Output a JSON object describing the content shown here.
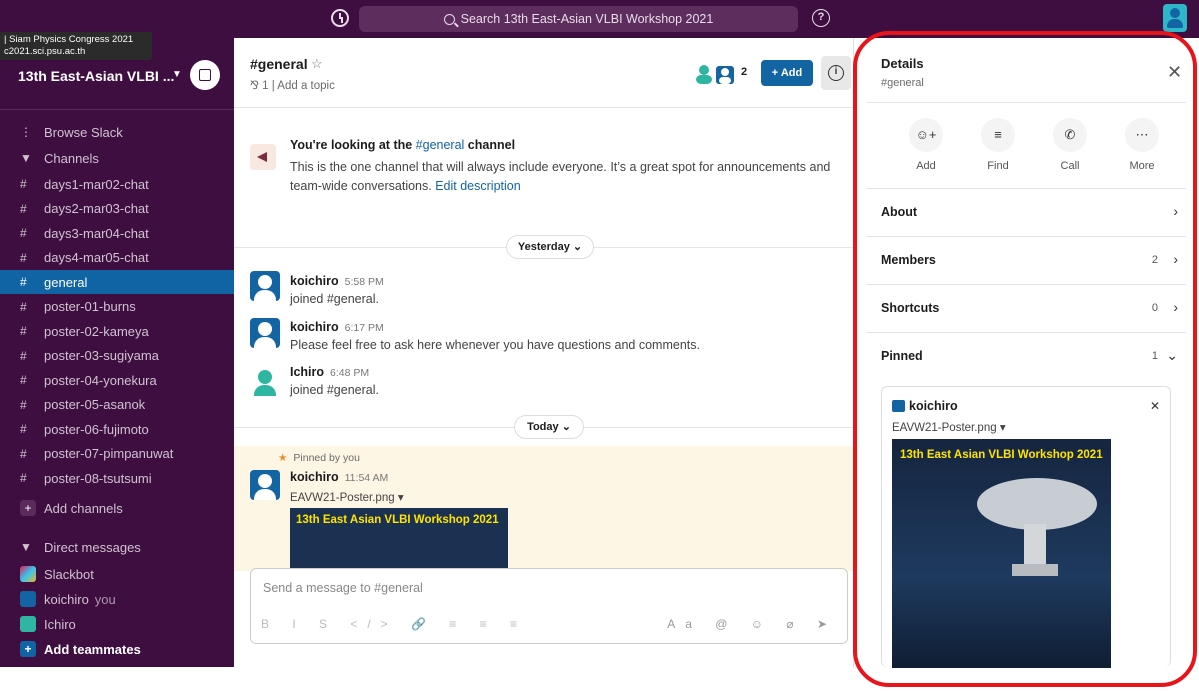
{
  "topbar": {
    "search_placeholder": "Search 13th East-Asian VLBI Workshop 2021"
  },
  "tooltip": {
    "line1": "| Siam Physics Congress 2021",
    "line2": "c2021.sci.psu.ac.th"
  },
  "sidebar": {
    "workspace": "13th East-Asian VLBI ...",
    "browse": "Browse Slack",
    "channels_header": "Channels",
    "channels": [
      "days1-mar02-chat",
      "days2-mar03-chat",
      "days3-mar04-chat",
      "days4-mar05-chat",
      "general",
      "poster-01-burns",
      "poster-02-kameya",
      "poster-03-sugiyama",
      "poster-04-yonekura",
      "poster-05-asanok",
      "poster-06-fujimoto",
      "poster-07-pimpanuwat",
      "poster-08-tsutsumi"
    ],
    "active_channel": "general",
    "add_channels": "Add channels",
    "dm_header": "Direct messages",
    "dms": [
      {
        "name": "Slackbot",
        "suffix": ""
      },
      {
        "name": "koichiro",
        "suffix": "you"
      },
      {
        "name": "Ichiro",
        "suffix": ""
      }
    ],
    "add_teammates": "Add teammates"
  },
  "channel": {
    "name": "#general",
    "star": "☆",
    "topic_meta": "⅋ 1 | Add a topic",
    "member_count": "2",
    "add_label": "+ Add",
    "intro_title": "You're looking at the ",
    "intro_channel": "#general",
    "intro_title_end": " channel",
    "intro_body": "This is the one channel that will always include everyone. It’s a great spot for announcements and team-wide conversations.",
    "edit_description": "Edit description",
    "day1": "Yesterday ⌄",
    "day2": "Today ⌄",
    "messages": [
      {
        "name": "koichiro",
        "time": "5:58 PM",
        "text": "joined #general."
      },
      {
        "name": "koichiro",
        "time": "6:17 PM",
        "text": "Please feel free to ask here whenever you have questions and comments."
      },
      {
        "name": "Ichiro",
        "time": "6:48 PM",
        "text": "joined #general."
      }
    ],
    "pinned_by": "Pinned by you",
    "pinned_msg": {
      "name": "koichiro",
      "time": "11:54 AM",
      "file": "EAVW21-Poster.png ▾"
    },
    "poster_title": "13th East Asian VLBI Workshop 2021",
    "composer_placeholder": "Send a message to #general",
    "composer_tools": "B  I  S  </>  🔗  ≡  ≡  ≡",
    "composer_tools_right": "Aa @ ☺ ⌀ ➤"
  },
  "details": {
    "title": "Details",
    "subtitle": "#general",
    "actions": [
      "Add",
      "Find",
      "Call",
      "More"
    ],
    "rows": [
      {
        "label": "About",
        "count": "",
        "chev": "›"
      },
      {
        "label": "Members",
        "count": "2",
        "chev": "›"
      },
      {
        "label": "Shortcuts",
        "count": "0",
        "chev": "›"
      },
      {
        "label": "Pinned",
        "count": "1",
        "chev": "⌄"
      }
    ],
    "pinned_card": {
      "name": "koichiro",
      "file": "EAVW21-Poster.png ▾",
      "poster_title": "13th East Asian VLBI Workshop 2021"
    }
  }
}
